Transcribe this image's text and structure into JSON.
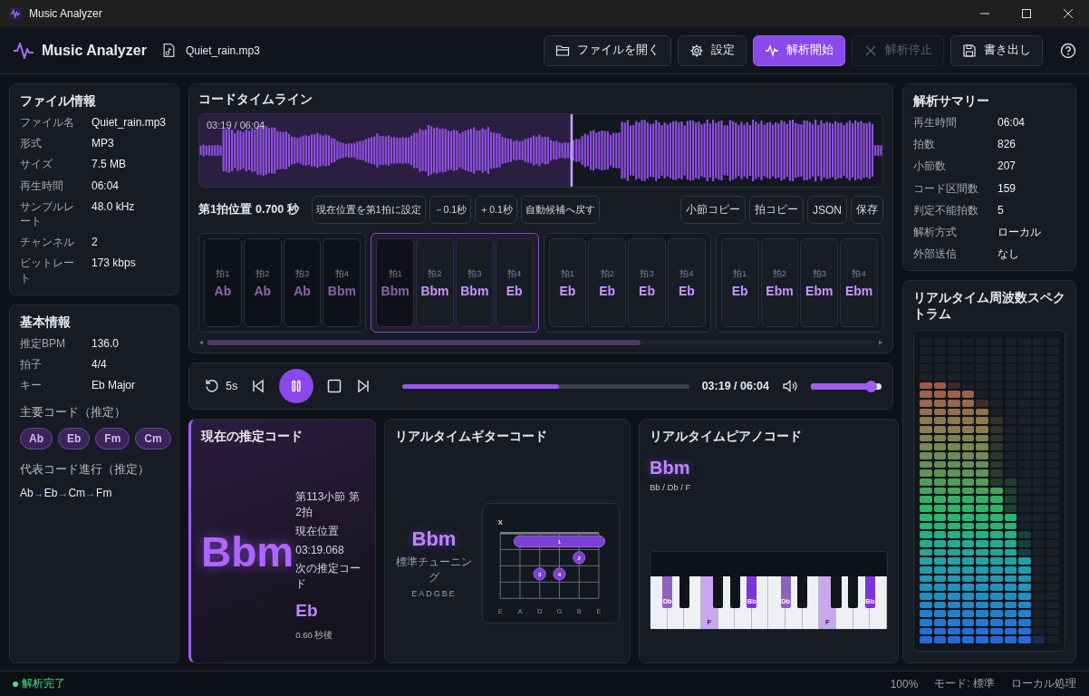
{
  "window": {
    "title": "Music Analyzer"
  },
  "header": {
    "app_name": "Music Analyzer",
    "file_name": "Quiet_rain.mp3",
    "buttons": [
      {
        "label": "ファイルを開く",
        "kind": "default",
        "disabled": false
      },
      {
        "label": "設定",
        "kind": "default",
        "disabled": false
      },
      {
        "label": "解析開始",
        "kind": "primary",
        "disabled": false
      },
      {
        "label": "解析停止",
        "kind": "default",
        "disabled": true
      },
      {
        "label": "書き出し",
        "kind": "default",
        "disabled": false
      }
    ]
  },
  "file_info": {
    "title": "ファイル情報",
    "rows": [
      {
        "label": "ファイル名",
        "value": "Quiet_rain.mp3"
      },
      {
        "label": "形式",
        "value": "MP3"
      },
      {
        "label": "サイズ",
        "value": "7.5 MB"
      },
      {
        "label": "再生時間",
        "value": "06:04"
      },
      {
        "label": "サンプルレート",
        "value": "48.0 kHz"
      },
      {
        "label": "チャンネル",
        "value": "2"
      },
      {
        "label": "ビットレート",
        "value": "173 kbps"
      }
    ]
  },
  "basic_info": {
    "title": "基本情報",
    "rows": [
      {
        "label": "推定BPM",
        "value": "136.0"
      },
      {
        "label": "拍子",
        "value": "4/4"
      },
      {
        "label": "キー",
        "value": "Eb Major"
      }
    ],
    "main_chords_title": "主要コード（推定）",
    "main_chords": [
      "Ab",
      "Eb",
      "Fm",
      "Cm"
    ],
    "progression_title": "代表コード進行（推定）",
    "progression": {
      "chords": [
        "Ab",
        "Eb",
        "Cm",
        "Fm"
      ],
      "separator": "→"
    }
  },
  "timeline": {
    "title": "コードタイムライン",
    "waveform": {
      "time": "03:19 / 06:04",
      "level": 0.545
    },
    "first_beat": {
      "label": "第1拍位置",
      "value": "0.700 秒"
    },
    "left_buttons": [
      "現在位置を第1拍に設定",
      "－0.1秒",
      "＋0.1秒",
      "自動候補へ戻す"
    ],
    "right_buttons": [
      "小節コピー",
      "拍コピー",
      "JSON",
      "保存"
    ],
    "measures": [
      {
        "selected": false,
        "beats": [
          {
            "label": "拍1",
            "chord": "Ab",
            "past": true
          },
          {
            "label": "拍2",
            "chord": "Ab",
            "past": true
          },
          {
            "label": "拍3",
            "chord": "Ab",
            "past": true
          },
          {
            "label": "拍4",
            "chord": "Bbm",
            "past": true
          }
        ]
      },
      {
        "selected": true,
        "beats": [
          {
            "label": "拍1",
            "chord": "Bbm",
            "past": true
          },
          {
            "label": "拍2",
            "chord": "Bbm",
            "past": false
          },
          {
            "label": "拍3",
            "chord": "Bbm",
            "past": false
          },
          {
            "label": "拍4",
            "chord": "Eb",
            "past": false
          }
        ]
      },
      {
        "selected": false,
        "beats": [
          {
            "label": "拍1",
            "chord": "Eb",
            "past": false
          },
          {
            "label": "拍2",
            "chord": "Eb",
            "past": false
          },
          {
            "label": "拍3",
            "chord": "Eb",
            "past": false
          },
          {
            "label": "拍4",
            "chord": "Eb",
            "past": false
          }
        ]
      },
      {
        "selected": false,
        "beats": [
          {
            "label": "拍1",
            "chord": "Eb",
            "past": false
          },
          {
            "label": "拍2",
            "chord": "Ebm",
            "past": false
          },
          {
            "label": "拍3",
            "chord": "Ebm",
            "past": false
          },
          {
            "label": "拍4",
            "chord": "Ebm",
            "past": false
          }
        ]
      }
    ]
  },
  "player": {
    "skip_label": "5s",
    "playing": true,
    "level": 0.545,
    "time": "03:19 / 06:04",
    "volume": {
      "level": 0.85
    }
  },
  "current_chord": {
    "title": "現在の推定コード",
    "chord": "Bbm",
    "position": "第113小節 第2拍",
    "position_label": "現在位置",
    "time": "03:19.068",
    "next_label": "次の推定コード",
    "next_chord": "Eb",
    "next_in": "0.60 秒後"
  },
  "guitar": {
    "title": "リアルタイムギターコード",
    "chord": "Bbm",
    "tuning_label": "標準チューニング",
    "tuning": "EADGBE",
    "muted_mark": "X",
    "strings": [
      {
        "name": "E",
        "muted": true
      },
      {
        "name": "A",
        "muted": false
      },
      {
        "name": "D",
        "muted": false
      },
      {
        "name": "G",
        "muted": false
      },
      {
        "name": "B",
        "muted": false
      },
      {
        "name": "E",
        "muted": false
      }
    ],
    "fingers": [
      {
        "label": "1",
        "kind": "barre"
      },
      {
        "label": "2",
        "kind": "dot"
      },
      {
        "label": "3",
        "kind": "dot"
      },
      {
        "label": "4",
        "kind": "dot"
      }
    ]
  },
  "piano": {
    "title": "リアルタイムピアノコード",
    "chord": "Bbm",
    "notes": "Bb / Db / F",
    "keys": [
      {
        "kind": "white"
      },
      {
        "kind": "black",
        "color": "#8d62bf",
        "label": "Db"
      },
      {
        "kind": "white"
      },
      {
        "kind": "black"
      },
      {
        "kind": "white"
      },
      {
        "kind": "white",
        "color": "#c9a6ee",
        "label": "F"
      },
      {
        "kind": "black"
      },
      {
        "kind": "white"
      },
      {
        "kind": "black"
      },
      {
        "kind": "white"
      },
      {
        "kind": "black",
        "color": "#7c34dc",
        "label": "Bb"
      },
      {
        "kind": "white"
      },
      {
        "kind": "white"
      },
      {
        "kind": "black",
        "color": "#8d62bf",
        "label": "Db"
      },
      {
        "kind": "white"
      },
      {
        "kind": "black"
      },
      {
        "kind": "white"
      },
      {
        "kind": "white",
        "color": "#c9a6ee",
        "label": "F"
      },
      {
        "kind": "black"
      },
      {
        "kind": "white"
      },
      {
        "kind": "black"
      },
      {
        "kind": "white"
      },
      {
        "kind": "black",
        "color": "#7c34dc",
        "label": "Bb"
      },
      {
        "kind": "white"
      }
    ]
  },
  "summary": {
    "title": "解析サマリー",
    "rows": [
      {
        "label": "再生時間",
        "value": "06:04"
      },
      {
        "label": "拍数",
        "value": "826"
      },
      {
        "label": "小節数",
        "value": "207"
      },
      {
        "label": "コード区間数",
        "value": "159"
      },
      {
        "label": "判定不能拍数",
        "value": "5"
      },
      {
        "label": "解析方式",
        "value": "ローカル"
      },
      {
        "label": "外部送信",
        "value": "なし"
      }
    ]
  },
  "spectrum": {
    "title": "リアルタイム周波数スペクトラム"
  },
  "status_bar": {
    "status": "解析完了",
    "zoom": "100%",
    "mode": "モード: 標準",
    "processing": "ローカル処理"
  }
}
